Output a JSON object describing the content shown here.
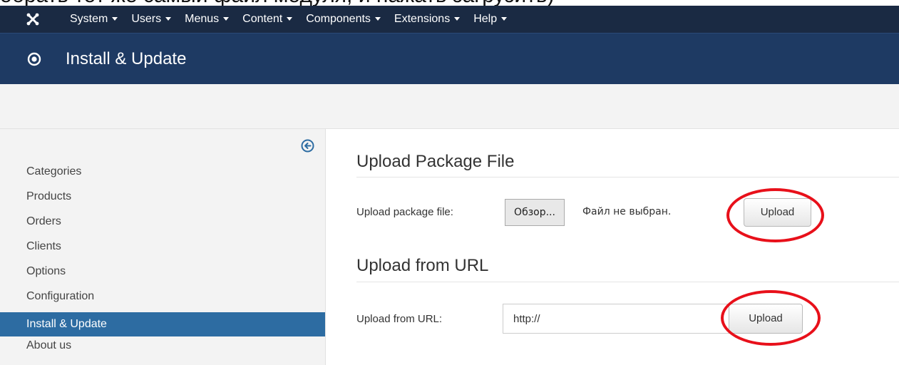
{
  "caption_text": "обрать тот же самый файл модуля, и нажать загрузить)",
  "menu": [
    {
      "label": "System"
    },
    {
      "label": "Users"
    },
    {
      "label": "Menus"
    },
    {
      "label": "Content"
    },
    {
      "label": "Components"
    },
    {
      "label": "Extensions"
    },
    {
      "label": "Help"
    }
  ],
  "page": {
    "title": "Install & Update",
    "title_icon": "radio-target-icon"
  },
  "sidebar": {
    "collapse_icon": "circle-arrow-left-icon",
    "items": [
      {
        "label": "Categories",
        "active": false
      },
      {
        "label": "Products",
        "active": false
      },
      {
        "label": "Orders",
        "active": false
      },
      {
        "label": "Clients",
        "active": false
      },
      {
        "label": "Options",
        "active": false
      },
      {
        "label": "Configuration",
        "active": false
      },
      {
        "label": "Install & Update",
        "active": true
      },
      {
        "label": "About us",
        "active": false
      }
    ]
  },
  "upload_package": {
    "heading": "Upload Package File",
    "field_label": "Upload package file:",
    "browse_label": "Обзор...",
    "file_status": "Файл не выбран.",
    "button_label": "Upload"
  },
  "upload_url": {
    "heading": "Upload from URL",
    "field_label": "Upload from URL:",
    "input_value": "http://",
    "button_label": "Upload"
  },
  "colors": {
    "topnav": "#1a2a43",
    "titlebar": "#1e3a63",
    "active_item": "#2d6ca2",
    "annotation": "#e8101a"
  }
}
